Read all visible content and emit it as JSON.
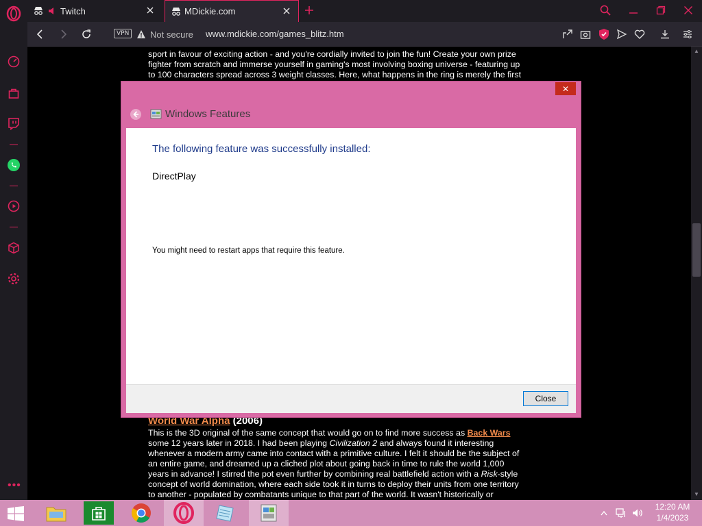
{
  "browser": {
    "tabs": [
      {
        "label": "Twitch"
      },
      {
        "label": "MDickie.com"
      }
    ],
    "address": {
      "vpn_label": "VPN",
      "security_label": "Not secure",
      "url": "www.mdickie.com/games_blitz.htm"
    },
    "colors": {
      "accent": "#e0245e",
      "chrome": "#1e1c22"
    }
  },
  "page": {
    "top_lines": [
      "sport in favour of exciting action - and you're cordially invited to join the fun! Create your own prize",
      "fighter from scratch and immerse yourself in gaming's most involving boxing universe - featuring up",
      "to 100 characters spread across 3 weight classes. Here, what happens in the ring is merely the first"
    ],
    "section_title": "World War Alpha",
    "section_year": "(2006)",
    "para_1": "This is the 3D original of the same concept that would go on to find more success as",
    "link_back_wars": "Back Wars",
    "para_2": "some 12 years later in 2018. I had been playing",
    "civ": "Civilization 2",
    "para_3": "and always found it interesting",
    "lines": [
      "whenever a modern army came into contact with a primitive culture. I felt it should be the subject of",
      "an entire game, and dreamed up a cliched plot about going back in time to rule the world 1,000",
      "years in advance! I stirred the pot even further by combining real battlefield action with a"
    ],
    "risk": "Risk",
    "risk_after": "-style",
    "lines_2": [
      "concept of world domination, where each side took it in turns to deploy their units from one territory",
      "to another - populated by combatants unique to that part of the world. It wasn't historically or"
    ]
  },
  "dialog": {
    "title": "Windows Features",
    "close_x": "✕",
    "heading": "The following feature was successfully installed:",
    "feature": "DirectPlay",
    "note": "You might need to restart apps that require this feature.",
    "close_button": "Close"
  },
  "taskbar": {
    "time": "12:20 AM",
    "date": "1/4/2023",
    "apps": [
      "file-explorer",
      "store",
      "chrome",
      "opera",
      "notepad",
      "control-panel"
    ]
  }
}
